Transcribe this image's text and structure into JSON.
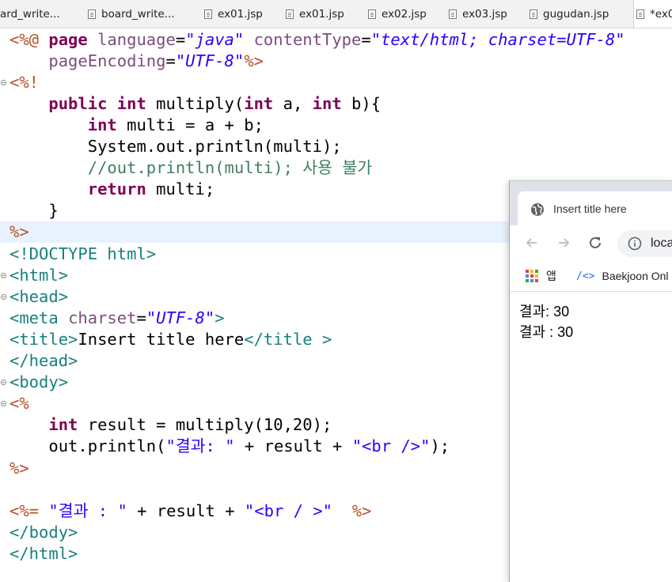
{
  "editor_tabs": [
    {
      "label": "ard_write...",
      "icon": false,
      "active": false
    },
    {
      "label": "board_write...",
      "icon": true,
      "active": false
    },
    {
      "label": "ex01.jsp",
      "icon": true,
      "active": false
    },
    {
      "label": "ex01.jsp",
      "icon": true,
      "active": false
    },
    {
      "label": "ex02.jsp",
      "icon": true,
      "active": false
    },
    {
      "label": "ex03.jsp",
      "icon": true,
      "active": false
    },
    {
      "label": "gugudan.jsp",
      "icon": true,
      "active": false
    },
    {
      "label": "*ex0",
      "icon": true,
      "active": true
    }
  ],
  "code_lines": [
    {
      "fold": false,
      "highlight": false,
      "tokens": [
        {
          "t": "<%@ ",
          "c": "delim"
        },
        {
          "t": "page ",
          "c": "kw"
        },
        {
          "t": "language",
          "c": "attr"
        },
        {
          "t": "=",
          "c": "plain"
        },
        {
          "t": "\"java\"",
          "c": "str"
        },
        {
          "t": " ",
          "c": "plain"
        },
        {
          "t": "contentType",
          "c": "attr"
        },
        {
          "t": "=",
          "c": "plain"
        },
        {
          "t": "\"text/html; charset=UTF-8\"",
          "c": "str"
        }
      ]
    },
    {
      "fold": false,
      "highlight": false,
      "tokens": [
        {
          "t": "    ",
          "c": "plain"
        },
        {
          "t": "pageEncoding",
          "c": "attr"
        },
        {
          "t": "=",
          "c": "plain"
        },
        {
          "t": "\"UTF-8\"",
          "c": "str"
        },
        {
          "t": "%>",
          "c": "delim"
        }
      ]
    },
    {
      "fold": true,
      "highlight": false,
      "tokens": [
        {
          "t": "<%!",
          "c": "delim"
        }
      ]
    },
    {
      "fold": false,
      "highlight": false,
      "tokens": [
        {
          "t": "    ",
          "c": "plain"
        },
        {
          "t": "public",
          "c": "kw"
        },
        {
          "t": " ",
          "c": "plain"
        },
        {
          "t": "int",
          "c": "kw"
        },
        {
          "t": " multiply(",
          "c": "plain"
        },
        {
          "t": "int",
          "c": "kw"
        },
        {
          "t": " a, ",
          "c": "plain"
        },
        {
          "t": "int",
          "c": "kw"
        },
        {
          "t": " b){",
          "c": "plain"
        }
      ]
    },
    {
      "fold": false,
      "highlight": false,
      "tokens": [
        {
          "t": "        ",
          "c": "plain"
        },
        {
          "t": "int",
          "c": "kw"
        },
        {
          "t": " multi = a + b;",
          "c": "plain"
        }
      ]
    },
    {
      "fold": false,
      "highlight": false,
      "tokens": [
        {
          "t": "        System.out.println(multi);",
          "c": "plain"
        }
      ]
    },
    {
      "fold": false,
      "highlight": false,
      "tokens": [
        {
          "t": "        ",
          "c": "plain"
        },
        {
          "t": "//out.println(multi); 사용 불가",
          "c": "comment"
        }
      ]
    },
    {
      "fold": false,
      "highlight": false,
      "tokens": [
        {
          "t": "        ",
          "c": "plain"
        },
        {
          "t": "return",
          "c": "kw"
        },
        {
          "t": " multi;",
          "c": "plain"
        }
      ]
    },
    {
      "fold": false,
      "highlight": false,
      "tokens": [
        {
          "t": "    }",
          "c": "plain"
        }
      ]
    },
    {
      "fold": false,
      "highlight": true,
      "tokens": [
        {
          "t": "%>",
          "c": "delim"
        }
      ]
    },
    {
      "fold": false,
      "highlight": false,
      "tokens": [
        {
          "t": "<!DOCTYPE html>",
          "c": "tag"
        }
      ]
    },
    {
      "fold": true,
      "highlight": false,
      "tokens": [
        {
          "t": "<html>",
          "c": "tag"
        }
      ]
    },
    {
      "fold": true,
      "highlight": false,
      "tokens": [
        {
          "t": "<head>",
          "c": "tag"
        }
      ]
    },
    {
      "fold": false,
      "highlight": false,
      "tokens": [
        {
          "t": "<meta ",
          "c": "tag"
        },
        {
          "t": "charset",
          "c": "attr"
        },
        {
          "t": "=",
          "c": "plain"
        },
        {
          "t": "\"UTF-8\"",
          "c": "str"
        },
        {
          "t": ">",
          "c": "tag"
        }
      ]
    },
    {
      "fold": false,
      "highlight": false,
      "tokens": [
        {
          "t": "<title>",
          "c": "tag"
        },
        {
          "t": "Insert title here",
          "c": "plain"
        },
        {
          "t": "</title >",
          "c": "tag"
        }
      ]
    },
    {
      "fold": false,
      "highlight": false,
      "tokens": [
        {
          "t": "</head>",
          "c": "tag"
        }
      ]
    },
    {
      "fold": true,
      "highlight": false,
      "tokens": [
        {
          "t": "<body>",
          "c": "tag"
        }
      ]
    },
    {
      "fold": true,
      "highlight": false,
      "tokens": [
        {
          "t": "<%",
          "c": "delim"
        }
      ]
    },
    {
      "fold": false,
      "highlight": false,
      "tokens": [
        {
          "t": "    ",
          "c": "plain"
        },
        {
          "t": "int",
          "c": "kw"
        },
        {
          "t": " result = multiply(10,20);",
          "c": "plain"
        }
      ]
    },
    {
      "fold": false,
      "highlight": false,
      "tokens": [
        {
          "t": "    out.println(",
          "c": "plain"
        },
        {
          "t": "\"결과: \"",
          "c": "plainstr"
        },
        {
          "t": " + result + ",
          "c": "plain"
        },
        {
          "t": "\"<br />\"",
          "c": "plainstr"
        },
        {
          "t": ");",
          "c": "plain"
        }
      ]
    },
    {
      "fold": false,
      "highlight": false,
      "tokens": [
        {
          "t": "%>",
          "c": "delim"
        }
      ]
    },
    {
      "fold": false,
      "highlight": false,
      "tokens": []
    },
    {
      "fold": false,
      "highlight": false,
      "tokens": [
        {
          "t": "<%= ",
          "c": "delim"
        },
        {
          "t": "\"결과 : \"",
          "c": "plainstr"
        },
        {
          "t": " + result + ",
          "c": "plain"
        },
        {
          "t": "\"<br / >\"",
          "c": "plainstr"
        },
        {
          "t": "  ",
          "c": "plain"
        },
        {
          "t": "%>",
          "c": "delim"
        }
      ]
    },
    {
      "fold": false,
      "highlight": false,
      "tokens": [
        {
          "t": "</body>",
          "c": "tag"
        }
      ]
    },
    {
      "fold": false,
      "highlight": false,
      "tokens": [
        {
          "t": "</html>",
          "c": "tag"
        }
      ]
    }
  ],
  "browser": {
    "tab_title": "Insert title here",
    "tab_icon": "globe-icon",
    "omnibox_text": "loca",
    "bookmarks": [
      {
        "label": "앱",
        "icon": "apps-grid-icon"
      },
      {
        "label": "Baekjoon Onl",
        "icon": "code-brackets-icon"
      }
    ],
    "output_lines": [
      "결과: 30",
      "결과 : 30"
    ],
    "colors": {
      "tabstrip": "#dee1e6",
      "omnibox": "#f1f3f4",
      "apps": [
        "#ea4335",
        "#fbbc04",
        "#34a853",
        "#4285f4",
        "#ea4335",
        "#fbbc04",
        "#34a853",
        "#4285f4",
        "#ea4335"
      ]
    }
  }
}
